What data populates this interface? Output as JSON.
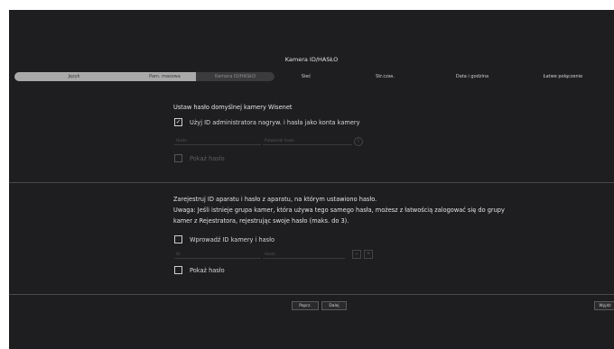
{
  "window": {
    "title": "Kamera ID/HASŁO"
  },
  "steps": [
    {
      "label": "Język"
    },
    {
      "label": "Pam. masowa"
    },
    {
      "label": "Kamera ID/HASŁO"
    },
    {
      "label": "Sieć"
    },
    {
      "label": "Str.czas."
    },
    {
      "label": "Data i godzina"
    },
    {
      "label": "Łatwe połączenie"
    }
  ],
  "section1": {
    "heading": "Ustaw hasło domyślnej kamery Wisenet",
    "use_admin_label": "Użyj ID administratora nagryw. i hasła jako konta kamery",
    "use_admin_checked": true,
    "password_placeholder": "Hasło",
    "confirm_placeholder": "Potwierdź hasło",
    "show_password_label": "Pokaż hasło"
  },
  "section2": {
    "line1": "Zarejestruj ID aparatu i hasło z aparatu, na którym ustawiono hasło.",
    "line2": "Uwaga: Jeśli istnieje grupa kamer, która używa tego samego hasła, możesz z łatwością zalogować się do grupy",
    "line3": "kamer z Rejestratora, rejestrując swoje hasło (maks. do 3).",
    "enter_id_label": "Wprowadź ID kamery i hasło",
    "id_placeholder": "ID",
    "password_placeholder": "Hasło",
    "minus_label": "−",
    "plus_label": "+",
    "show_password_label": "Pokaż hasło"
  },
  "footer": {
    "prev_label": "Poprz.",
    "next_label": "Dalej",
    "exit_label": "Wyjdź"
  },
  "icons": {
    "check": "checkmark-icon",
    "info": "info-icon"
  }
}
